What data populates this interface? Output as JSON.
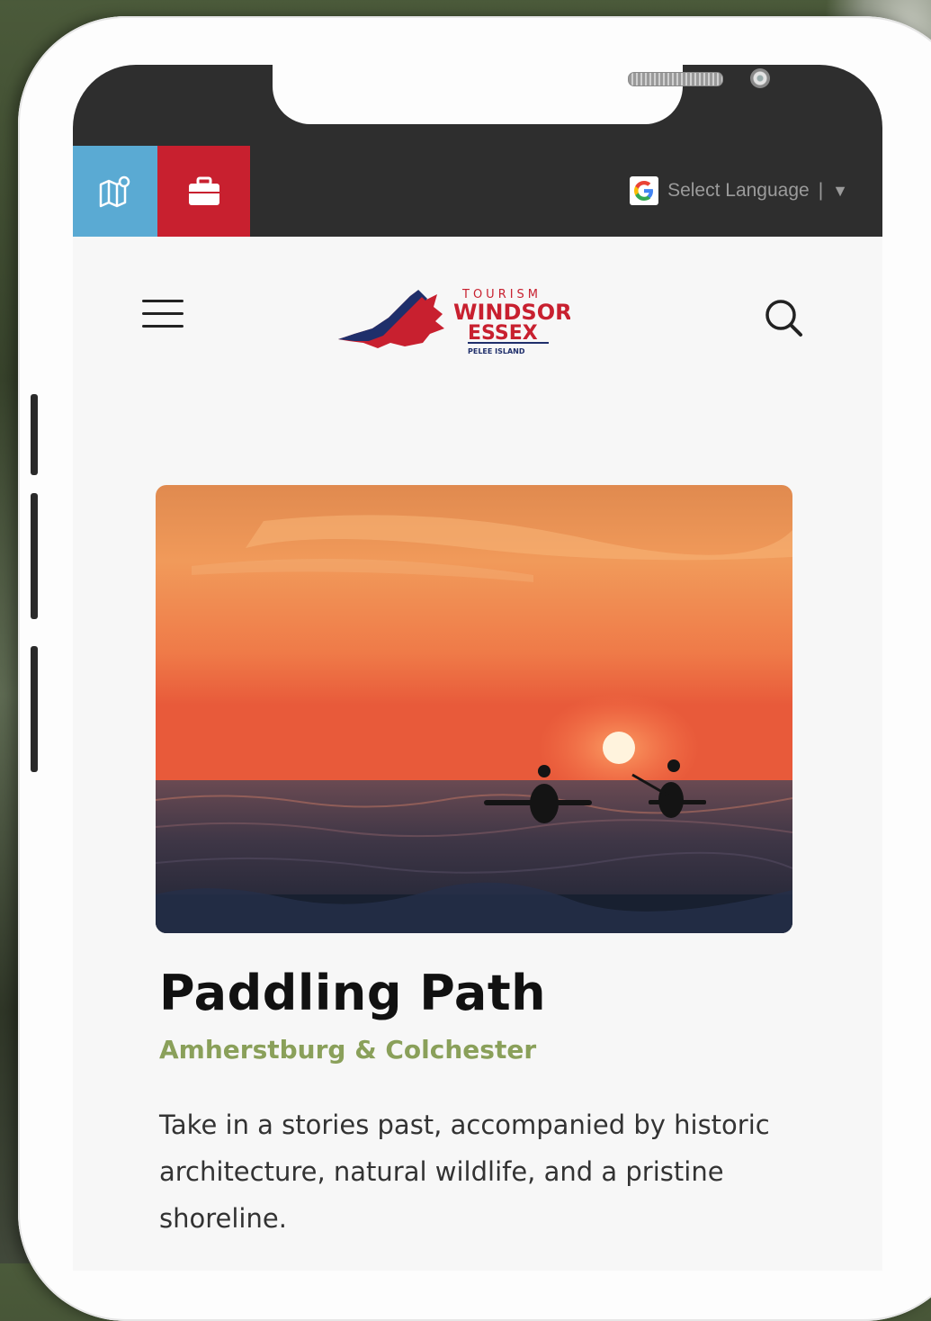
{
  "topbar": {
    "language_label": "Select Language",
    "language_separator": "|",
    "language_arrow": "▼"
  },
  "logo": {
    "line1": "TOURISM",
    "line2": "WINDSOR",
    "line3": "ESSEX",
    "line4": "PELEE ISLAND"
  },
  "card": {
    "title": "Paddling Path",
    "location": "Amherstburg & Colchester",
    "description": "Take in a stories past, accompanied by historic architecture, natural wildlife, and a pristine shoreline."
  },
  "colors": {
    "map_button": "#5aaad3",
    "briefcase_button": "#c8202f",
    "location_text": "#8aa05a"
  },
  "icons": [
    "map-pin-icon",
    "briefcase-icon",
    "google-g-icon",
    "menu-icon",
    "search-icon"
  ]
}
